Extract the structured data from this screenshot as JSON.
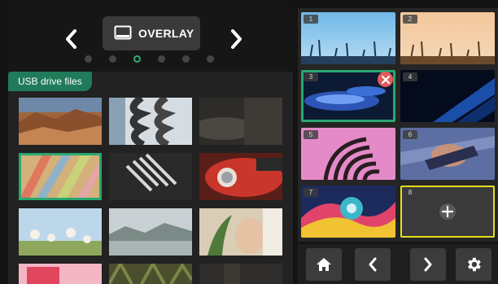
{
  "mode": {
    "label": "OVERLAY",
    "icon": "monitor-icon"
  },
  "pager": {
    "count": 6,
    "active_index": 2
  },
  "files": {
    "tag": "USB drive files",
    "selected_index": 3,
    "thumbnails": [
      "desert-rocks",
      "curved-balconies",
      "dark-leaf",
      "colorful-fabric",
      "striped-chair",
      "red-car",
      "white-flowers",
      "mountain-lake",
      "hand-with-plant",
      "pink-frame",
      "palm-trees",
      "dark-wall"
    ]
  },
  "channels": {
    "active": "3",
    "add_icon": "plus-icon",
    "items": [
      {
        "num": "1",
        "image": "blue-grass-sky"
      },
      {
        "num": "2",
        "image": "orange-grass-sky"
      },
      {
        "num": "3",
        "image": "blue-glass-abstract"
      },
      {
        "num": "4",
        "image": "blue-diagonal"
      },
      {
        "num": "5",
        "image": "pink-building"
      },
      {
        "num": "6",
        "image": "blue-motion"
      },
      {
        "num": "7",
        "image": "color-marble"
      },
      {
        "num": "8",
        "image": ""
      }
    ]
  },
  "controls": [
    "home-icon",
    "chevron-left-icon",
    "chevron-right-icon",
    "gear-icon"
  ],
  "colors": {
    "accent": "#27a86f",
    "highlight": "#e4de1c",
    "remove": "#e35a5a"
  }
}
